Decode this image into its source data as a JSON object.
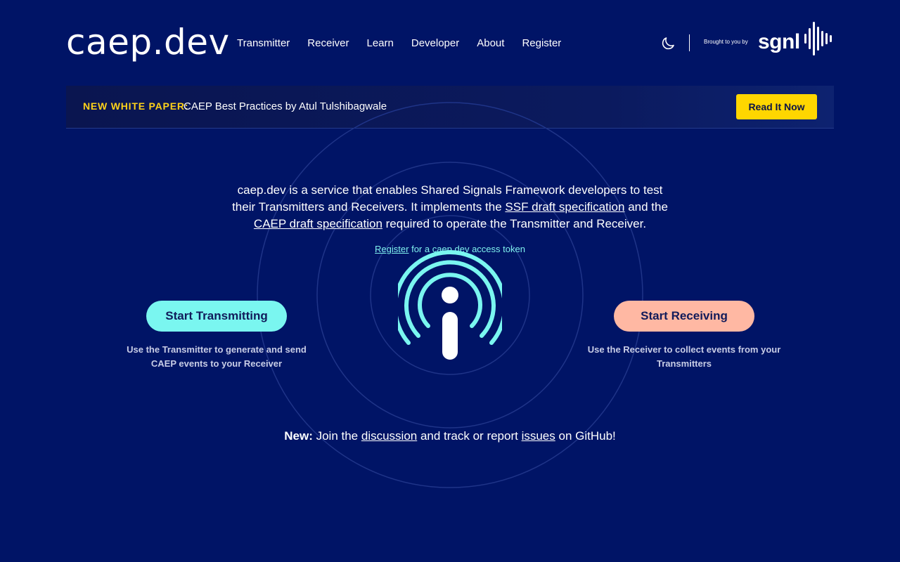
{
  "header": {
    "logo": "caep.dev",
    "nav": [
      "Transmitter",
      "Receiver",
      "Learn",
      "Developer",
      "About",
      "Register"
    ],
    "brought_by": "Brought to you by",
    "brand": "sgnl"
  },
  "banner": {
    "label": "NEW WHITE PAPER:",
    "text": "CAEP Best Practices by Atul Tulshibagwale",
    "button": "Read It Now"
  },
  "intro": {
    "part1": "caep.dev is a service that enables Shared Signals Framework developers to test their Transmitters and Receivers. It implements the ",
    "link1": "SSF draft specification",
    "part2": " and the ",
    "link2": "CAEP draft specification",
    "part3": " required to operate the Transmitter and Receiver."
  },
  "register": {
    "link": "Register",
    "text": " for a caep.dev access token"
  },
  "transmitter": {
    "button": "Start Transmitting",
    "desc": "Use the Transmitter to generate and send CAEP events to your Receiver"
  },
  "receiver": {
    "button": "Start Receiving",
    "desc": "Use the Receiver to collect events from your Transmitters"
  },
  "footer_note": {
    "new": "New:",
    "t1": " Join the ",
    "link1": "discussion",
    "t2": " and track or report ",
    "link2": "issues",
    "t3": " on GitHub!"
  },
  "colors": {
    "background": "#001466",
    "accent_yellow": "#ffd600",
    "accent_cyan": "#7af6f0",
    "accent_peach": "#ffb8a3"
  },
  "icons": {
    "theme_toggle": "moon-icon",
    "center": "broadcast-signal-icon"
  }
}
